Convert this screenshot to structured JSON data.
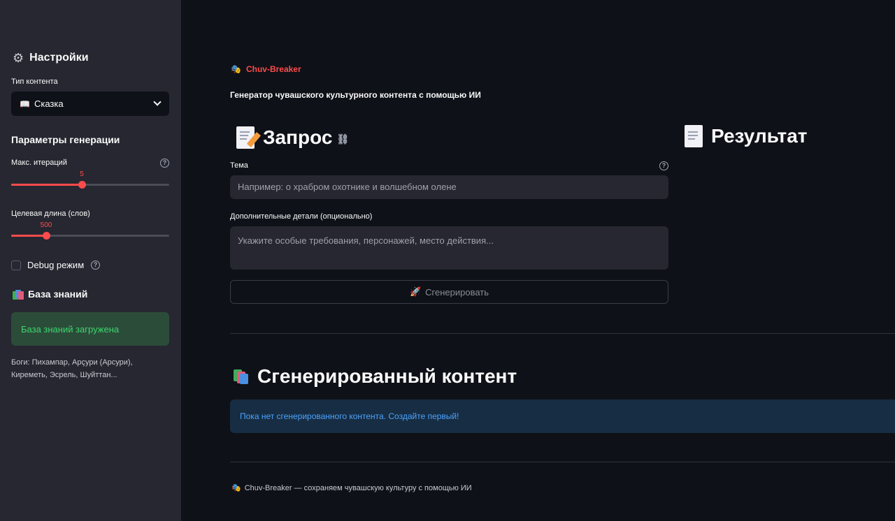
{
  "sidebar": {
    "title": "Настройки",
    "content_type_label": "Тип контента",
    "content_type_icon": "📖",
    "content_type_value": "Сказка",
    "gen_params_title": "Параметры генерации",
    "max_iter_label": "Макс. итераций",
    "max_iter_value": "5",
    "max_iter_fraction": 0.45,
    "target_len_label": "Целевая длина (слов)",
    "target_len_value": "500",
    "target_len_fraction": 0.22,
    "debug_label": "Debug режим",
    "debug_checked": false,
    "kb_title": "База знаний",
    "kb_status": "База знаний загружена",
    "kb_caption": "Боги: Пихампар, Арçури (Арсури), Киреметь, Эсрель, Шуйттан..."
  },
  "main": {
    "brand": "Chuv-Breaker",
    "subtitle": "Генератор чувашского культурного контента с помощью ИИ",
    "request_title": "Запрос",
    "result_title": "Результат",
    "topic_label": "Тема",
    "topic_placeholder": "Например: о храбром охотнике и волшебном олене",
    "details_label": "Дополнительные детали (опционально)",
    "details_placeholder": "Укажите особые требования, персонажей, место действия...",
    "generate_icon": "🚀",
    "generate_label": "Сгенерировать",
    "generated_title": "Сгенерированный контент",
    "empty_info": "Пока нет сгенерированного контента. Создайте первый!",
    "footer": "Chuv-Breaker — сохраняем чувашскую культуру с помощью ИИ"
  },
  "colors": {
    "accent": "#ff4b4b",
    "success_text": "#3dd56d",
    "info_text": "#4ca3ff",
    "background": "#0e1117",
    "sidebar": "#262730"
  },
  "icons": {
    "settings": "gear-icon",
    "select_chevron": "chevron-down-icon",
    "help": "help-icon",
    "knowledge_base": "books-icon",
    "brand": "theater-masks-icon",
    "request": "memo-icon",
    "result": "document-icon",
    "anchor": "link-icon",
    "generate": "rocket-icon"
  }
}
